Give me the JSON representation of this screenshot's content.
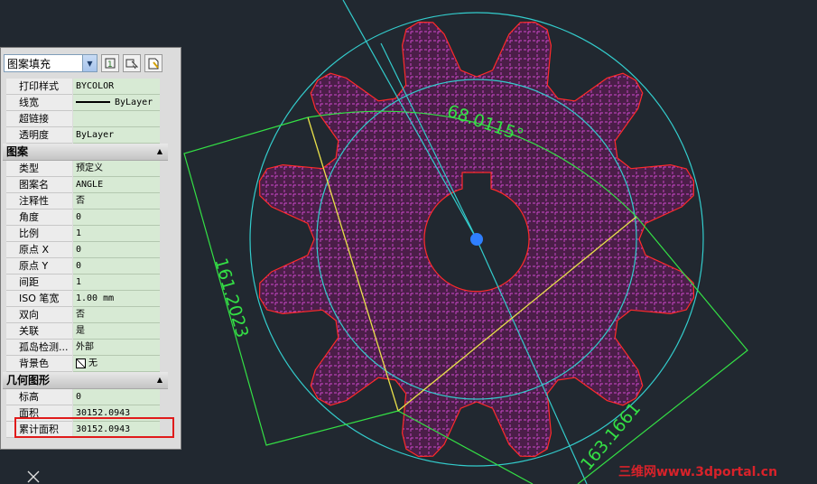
{
  "drawing": {
    "angle_dim": "68.0115°",
    "dim_left": "161.2023",
    "dim_right": "163.1661",
    "watermark": "三维网www.3dportal.cn",
    "colors": {
      "background": "#212830",
      "cyan": "#33cccc",
      "red": "#ff2a2a",
      "hatch": "#c23ac2",
      "green": "#34e045",
      "yellow": "#e8e04a"
    }
  },
  "palette": {
    "object_type": "图案填充",
    "toolbar_icons": [
      "toggle-pickadd-icon",
      "select-objects-icon",
      "quick-select-icon"
    ],
    "general_rows": [
      {
        "key": "打印样式",
        "value": "BYCOLOR"
      },
      {
        "key": "线宽",
        "value": "ByLayer"
      },
      {
        "key": "超链接",
        "value": ""
      },
      {
        "key": "透明度",
        "value": "ByLayer"
      }
    ],
    "pattern_title": "图案",
    "pattern_rows": [
      {
        "key": "类型",
        "value": "预定义"
      },
      {
        "key": "图案名",
        "value": "ANGLE"
      },
      {
        "key": "注释性",
        "value": "否"
      },
      {
        "key": "角度",
        "value": "0"
      },
      {
        "key": "比例",
        "value": "1"
      },
      {
        "key": "原点 X",
        "value": "0"
      },
      {
        "key": "原点 Y",
        "value": "0"
      },
      {
        "key": "间距",
        "value": "1"
      },
      {
        "key": "ISO 笔宽",
        "value": "1.00 mm"
      },
      {
        "key": "双向",
        "value": "否"
      },
      {
        "key": "关联",
        "value": "是"
      },
      {
        "key": "孤岛检测...",
        "value": "外部"
      },
      {
        "key": "背景色",
        "value": "无"
      }
    ],
    "geometry_title": "几何图形",
    "geometry_rows": [
      {
        "key": "标高",
        "value": "0"
      },
      {
        "key": "面积",
        "value": "30152.0943"
      },
      {
        "key": "累计面积",
        "value": "30152.0943"
      }
    ]
  }
}
